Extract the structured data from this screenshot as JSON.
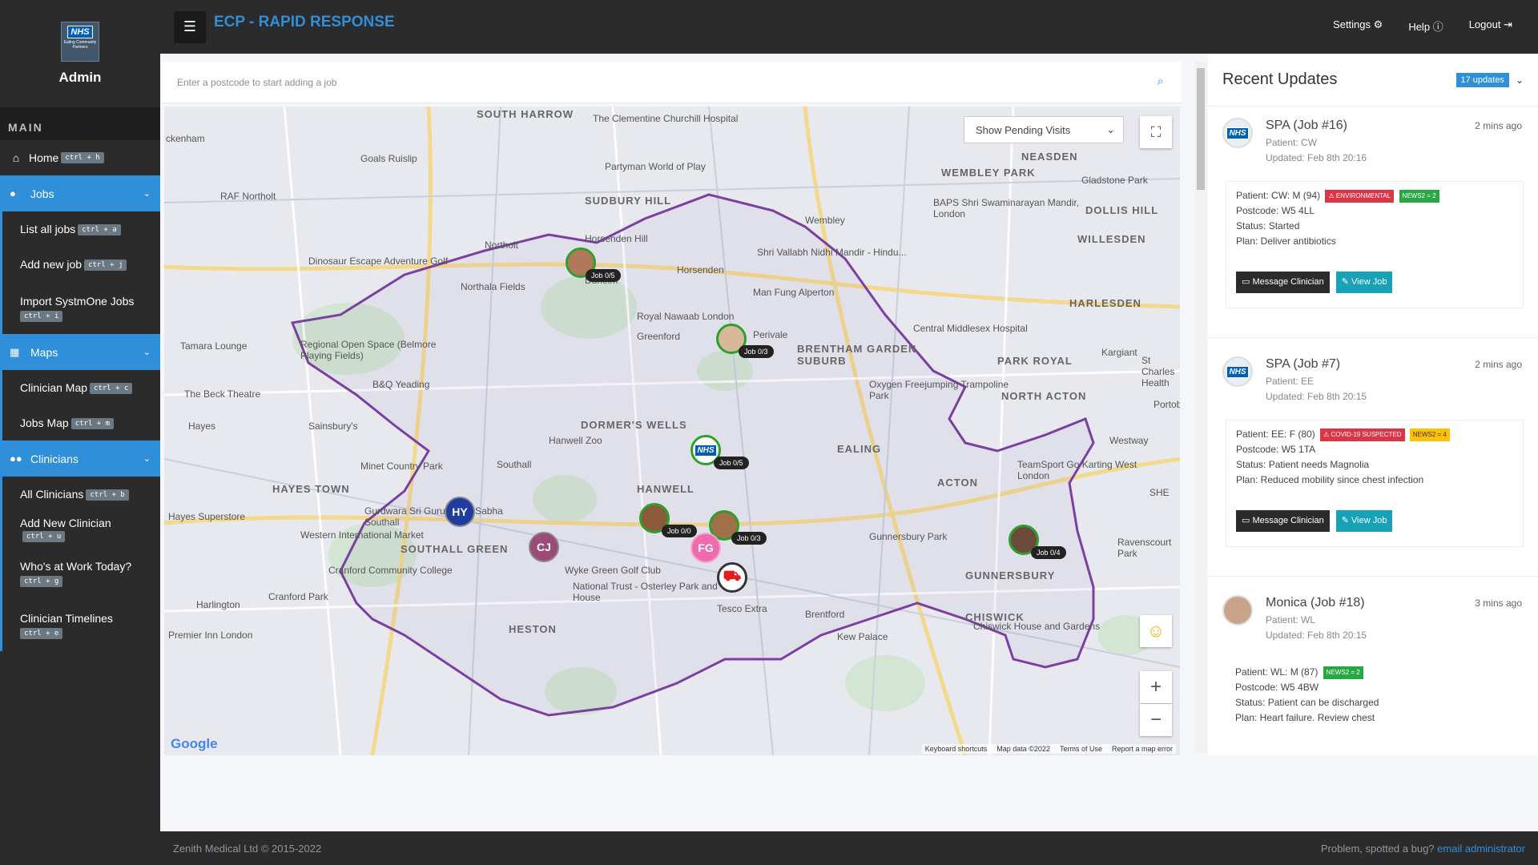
{
  "brand": {
    "nhs_badge": "NHS",
    "nhs_sub": "Ealing Community Partners",
    "title": "Admin"
  },
  "sidebar": {
    "section": "MAIN",
    "home": {
      "label": "Home",
      "kbd": "ctrl + h"
    },
    "groups": [
      {
        "label": "Jobs",
        "items": [
          {
            "label": "List all jobs",
            "kbd": "ctrl + a"
          },
          {
            "label": "Add new job",
            "kbd": "ctrl + j"
          },
          {
            "label": "Import SystmOne Jobs",
            "kbd": "ctrl + i"
          }
        ]
      },
      {
        "label": "Maps",
        "items": [
          {
            "label": "Clinician Map",
            "kbd": "ctrl + c"
          },
          {
            "label": "Jobs Map",
            "kbd": "ctrl + m"
          }
        ]
      },
      {
        "label": "Clinicians",
        "items": [
          {
            "label": "All Clinicians",
            "kbd": "ctrl + b"
          },
          {
            "label": "Add New Clinician",
            "kbd": "ctrl + u"
          },
          {
            "label": "Who's at Work Today?",
            "kbd": "ctrl + g"
          },
          {
            "label": "Clinician Timelines",
            "kbd": "ctrl + e"
          }
        ]
      }
    ]
  },
  "topbar": {
    "title": "ECP - RAPID RESPONSE",
    "settings": "Settings",
    "help": "Help",
    "logout": "Logout"
  },
  "search": {
    "placeholder": "Enter a postcode to start adding a job"
  },
  "map": {
    "filter_select": "Show Pending Visits",
    "zoom_in": "+",
    "zoom_out": "−",
    "google": "Google",
    "footer": [
      "Keyboard shortcuts",
      "Map data ©2022",
      "Terms of Use",
      "Report a map error"
    ],
    "markers": [
      {
        "initials": "HY",
        "color": "#1f3c9e"
      },
      {
        "initials": "CJ",
        "color": "#9b4a7a"
      },
      {
        "initials": "FG",
        "color": "#f06ab0"
      }
    ],
    "job_labels": [
      "Job 0/5",
      "Job 0/3",
      "Job 0/5",
      "Job 0/0",
      "Job 0/3",
      "Job 0/4"
    ],
    "places": [
      "SOUTH HARROW",
      "The Clementine Churchill Hospital",
      "ckenham",
      "Goals Ruislip",
      "Partyman World of Play",
      "NEASDEN",
      "WEMBLEY PARK",
      "Gladstone Park",
      "RAF Northolt",
      "SUDBURY HILL",
      "BAPS Shri Swaminarayan Mandir, London",
      "DOLLIS HILL",
      "Wembley",
      "Horsenden Hill",
      "WILLESDEN",
      "Northolt",
      "Dinosaur Escape Adventure Golf",
      "Shri Vallabh Nidhi Mandir - Hindu...",
      "Horsenden",
      "Dunelm",
      "Northala Fields",
      "Man Fung Alperton",
      "HARLESDEN",
      "Royal Nawaab London",
      "Perivale",
      "Central Middlesex Hospital",
      "Tamara Lounge",
      "Greenford",
      "BRENTHAM GARDEN SUBURB",
      "PARK ROYAL",
      "Regional Open Space (Belmore Playing Fields)",
      "Kargiant",
      "St Charles Health",
      "B&Q Yeading",
      "The Beck Theatre",
      "Oxygen Freejumping Trampoline Park",
      "NORTH ACTON",
      "Portob",
      "Hayes",
      "Sainsbury's",
      "DORMER'S WELLS",
      "Hanwell Zoo",
      "EALING",
      "Westway",
      "Southall",
      "TeamSport Go Karting West London",
      "Minet Country Park",
      "HAYES TOWN",
      "ACTON",
      "HANWELL",
      "SHE",
      "Gurdwara Sri Guru Singh Sabha Southall",
      "Hayes Superstore",
      "Western International Market",
      "SOUTHALL GREEN",
      "Gunnersbury Park",
      "Ravenscourt Park",
      "Cranford Community College",
      "Wyke Green Golf Club",
      "GUNNERSBURY",
      "Cranford Park",
      "National Trust - Osterley Park and House",
      "Harlington",
      "Tesco Extra",
      "Brentford",
      "CHISWICK",
      "Chiswick House and Gardens",
      "HESTON",
      "Premier Inn London",
      "Kew Palace"
    ]
  },
  "updates": {
    "title": "Recent Updates",
    "badge": "17 updates",
    "items": [
      {
        "title": "SPA (Job #16)",
        "patient": "Patient: CW",
        "updated": "Updated: Feb 8th 20:16",
        "time": "2 mins ago",
        "body_patient": "Patient: CW: M (94)",
        "tags": [
          {
            "text": "ENVIRONMENTAL",
            "kind": "red"
          },
          {
            "text": "NEWS2 = 2",
            "kind": "green"
          }
        ],
        "postcode": "Postcode: W5 4LL",
        "status": "Status: Started",
        "plan": "Plan: Deliver antibiotics",
        "msg": "Message Clinician",
        "view": "View Job",
        "avatar": "NHS"
      },
      {
        "title": "SPA (Job #7)",
        "patient": "Patient: EE",
        "updated": "Updated: Feb 8th 20:15",
        "time": "2 mins ago",
        "body_patient": "Patient: EE: F (80)",
        "tags": [
          {
            "text": "COVID-19 SUSPECTED",
            "kind": "red"
          },
          {
            "text": "NEWS2 = 4",
            "kind": "yellow"
          }
        ],
        "postcode": "Postcode: W5 1TA",
        "status": "Status: Patient needs Magnolia",
        "plan": "Plan: Reduced mobility since chest infection",
        "msg": "Message Clinician",
        "view": "View Job",
        "avatar": "NHS"
      },
      {
        "title": "Monica (Job #18)",
        "patient": "Patient: WL",
        "updated": "Updated: Feb 8th 20:15",
        "time": "3 mins ago",
        "body_patient": "Patient: WL: M (87)",
        "tags": [
          {
            "text": "NEWS2 = 2",
            "kind": "green"
          }
        ],
        "postcode": "Postcode: W5 4BW",
        "status": "Status: Patient can be discharged",
        "plan": "Plan: Heart failure. Review chest",
        "avatar": ""
      }
    ]
  },
  "footer": {
    "left": "Zenith Medical Ltd © 2015-2022",
    "right_text": "Problem, spotted a bug?",
    "right_link": "email administrator"
  }
}
